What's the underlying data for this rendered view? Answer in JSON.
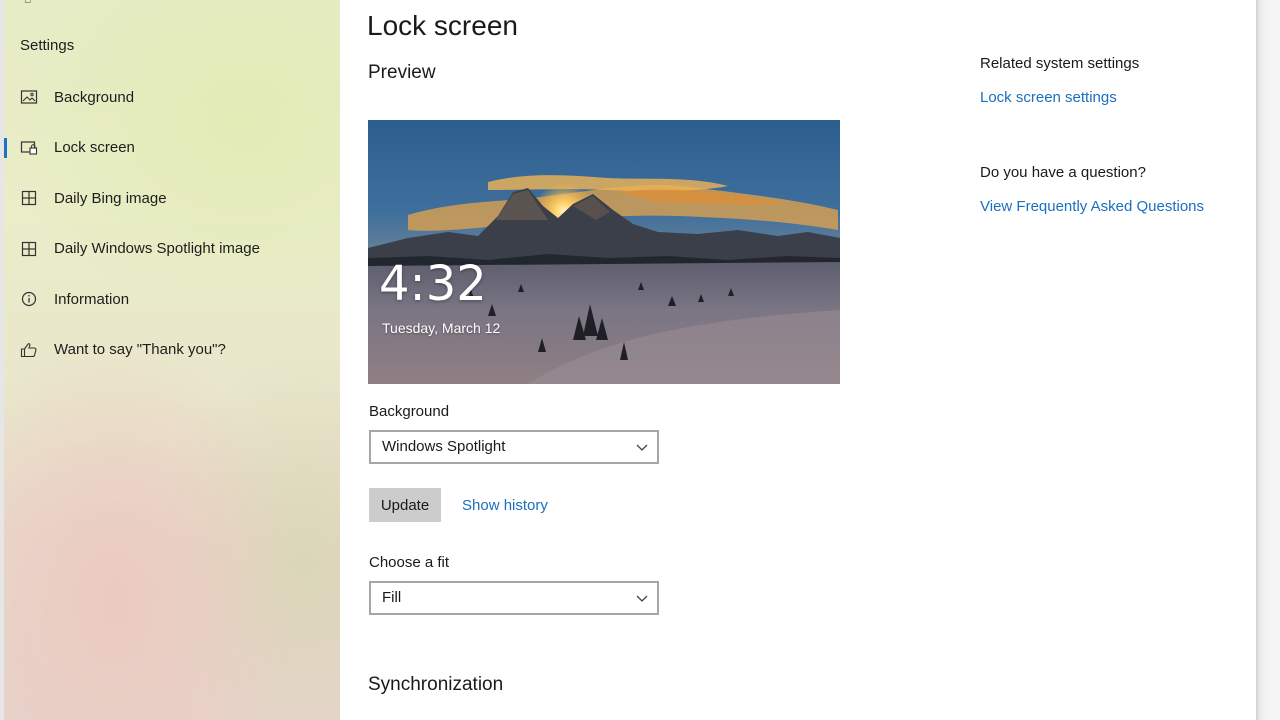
{
  "sidebar": {
    "title": "Settings",
    "items": [
      {
        "label": "Background",
        "icon": "image-icon",
        "active": false
      },
      {
        "label": "Lock screen",
        "icon": "lock-screen-icon",
        "active": true
      },
      {
        "label": "Daily Bing image",
        "icon": "grid-icon",
        "active": false
      },
      {
        "label": "Daily Windows Spotlight image",
        "icon": "grid-icon",
        "active": false
      },
      {
        "label": "Information",
        "icon": "info-icon",
        "active": false
      },
      {
        "label": "Want to say \"Thank you\"?",
        "icon": "thumbs-up-icon",
        "active": false
      }
    ]
  },
  "main": {
    "title": "Lock screen",
    "preview_heading": "Preview",
    "preview": {
      "time": "4:32",
      "date": "Tuesday, March 12"
    },
    "background_label": "Background",
    "background_value": "Windows Spotlight",
    "update_label": "Update",
    "show_history_label": "Show history",
    "fit_label": "Choose a fit",
    "fit_value": "Fill",
    "sync_heading": "Synchronization"
  },
  "related": {
    "heading": "Related system settings",
    "link": "Lock screen settings",
    "question_heading": "Do you have a question?",
    "faq_link": "View Frequently Asked Questions"
  },
  "colors": {
    "accent": "#1a73c6",
    "link": "#1b6fbf",
    "button_bg": "#cccccc"
  }
}
